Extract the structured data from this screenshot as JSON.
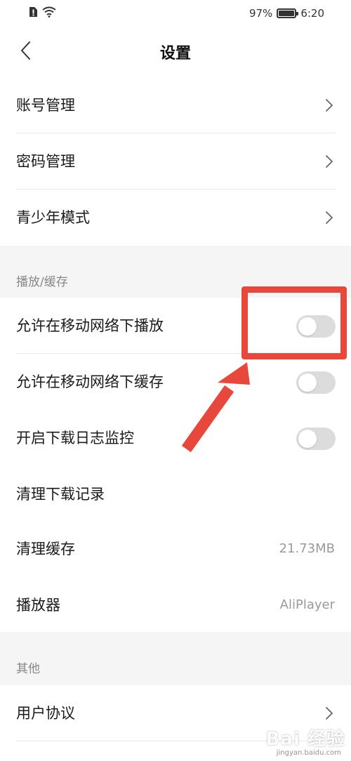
{
  "status_bar": {
    "battery_percent": "97%",
    "battery_level": 0.97,
    "time": "6:20",
    "icons": [
      "sim-alert-icon",
      "wifi-icon",
      "battery-icon"
    ]
  },
  "header": {
    "title": "设置",
    "back_icon": "chevron-left-icon"
  },
  "account_section": {
    "items": [
      {
        "label": "账号管理"
      },
      {
        "label": "密码管理"
      },
      {
        "label": "青少年模式"
      }
    ]
  },
  "playback_section": {
    "title": "播放/缓存",
    "toggles": [
      {
        "label": "允许在移动网络下播放",
        "on": false
      },
      {
        "label": "允许在移动网络下缓存",
        "on": false
      },
      {
        "label": "开启下载日志监控",
        "on": false
      }
    ],
    "actions": [
      {
        "label": "清理下载记录",
        "value": ""
      },
      {
        "label": "清理缓存",
        "value": "21.73MB"
      },
      {
        "label": "播放器",
        "value": "AliPlayer"
      }
    ]
  },
  "other_section": {
    "title": "其他",
    "items": [
      {
        "label": "用户协议"
      }
    ]
  },
  "annotation": {
    "color": "#e8473c"
  },
  "watermark": {
    "text": "Bai 经验",
    "sub": "jingyan.baidu.com"
  },
  "colors": {
    "background": "#ffffff",
    "section_background": "#f5f5f5",
    "toggle_off": "#dcdcdc",
    "annotation_red": "#e8473c"
  }
}
